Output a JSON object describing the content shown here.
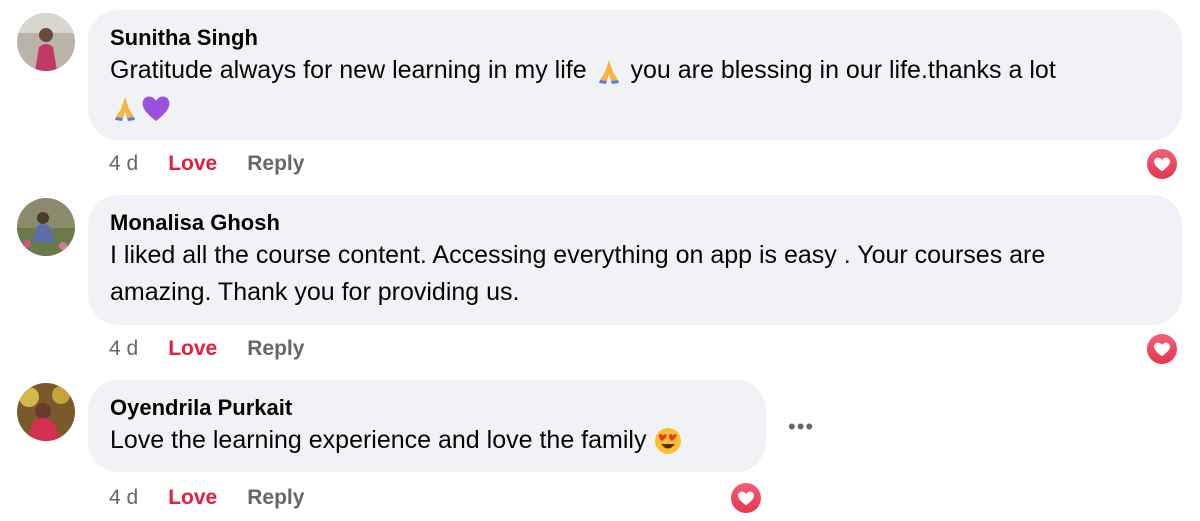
{
  "comments": [
    {
      "author": "Sunitha Singh",
      "line1": "Gratitude always for new learning in my life",
      "line1b": "you are blessing in our life.thanks a lot",
      "time": "4 d",
      "love": "Love",
      "reply": "Reply"
    },
    {
      "author": "Monalisa Ghosh",
      "line1": "I liked all the course content. Accessing everything on app is easy . Your courses are",
      "line2": "amazing. Thank you for providing us.",
      "time": "4 d",
      "love": "Love",
      "reply": "Reply"
    },
    {
      "author": "Oyendrila Purkait",
      "line1": "Love the learning experience and love the family",
      "time": "4 d",
      "love": "Love",
      "reply": "Reply"
    }
  ],
  "more_label": "•••",
  "colors": {
    "bubble": "#f0f2f5",
    "love": "#e41e3f",
    "muted": "#65676b",
    "reaction": "#f0415f"
  },
  "icons": [
    "praying-hands-icon",
    "purple-heart-icon",
    "heart-eyes-icon",
    "heart-reaction-icon",
    "more-options-icon"
  ]
}
